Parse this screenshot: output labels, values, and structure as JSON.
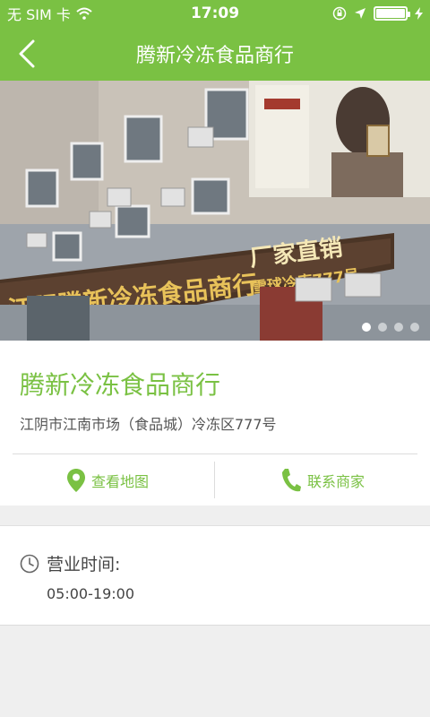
{
  "status_bar": {
    "carrier": "无 SIM 卡",
    "time": "17:09"
  },
  "nav": {
    "title": "腾新冷冻食品商行"
  },
  "hero": {
    "sign_main": "江阴腾新冷冻食品商行",
    "sign_right_top": "厂家直销",
    "sign_right_bottom": "雪球冷库777号",
    "page_count": 4,
    "active_page": 1
  },
  "store": {
    "name": "腾新冷冻食品商行",
    "address": "江阴市江南市场（食品城）冷冻区777号",
    "map_label": "查看地图",
    "contact_label": "联系商家"
  },
  "hours": {
    "label": "营业时间:",
    "value": "05:00-19:00"
  },
  "colors": {
    "brand_green": "#7ac143",
    "background": "#efefef"
  },
  "icons": {
    "back": "chevron-left-icon",
    "map": "map-pin-icon",
    "contact": "phone-icon",
    "hours": "clock-icon"
  }
}
